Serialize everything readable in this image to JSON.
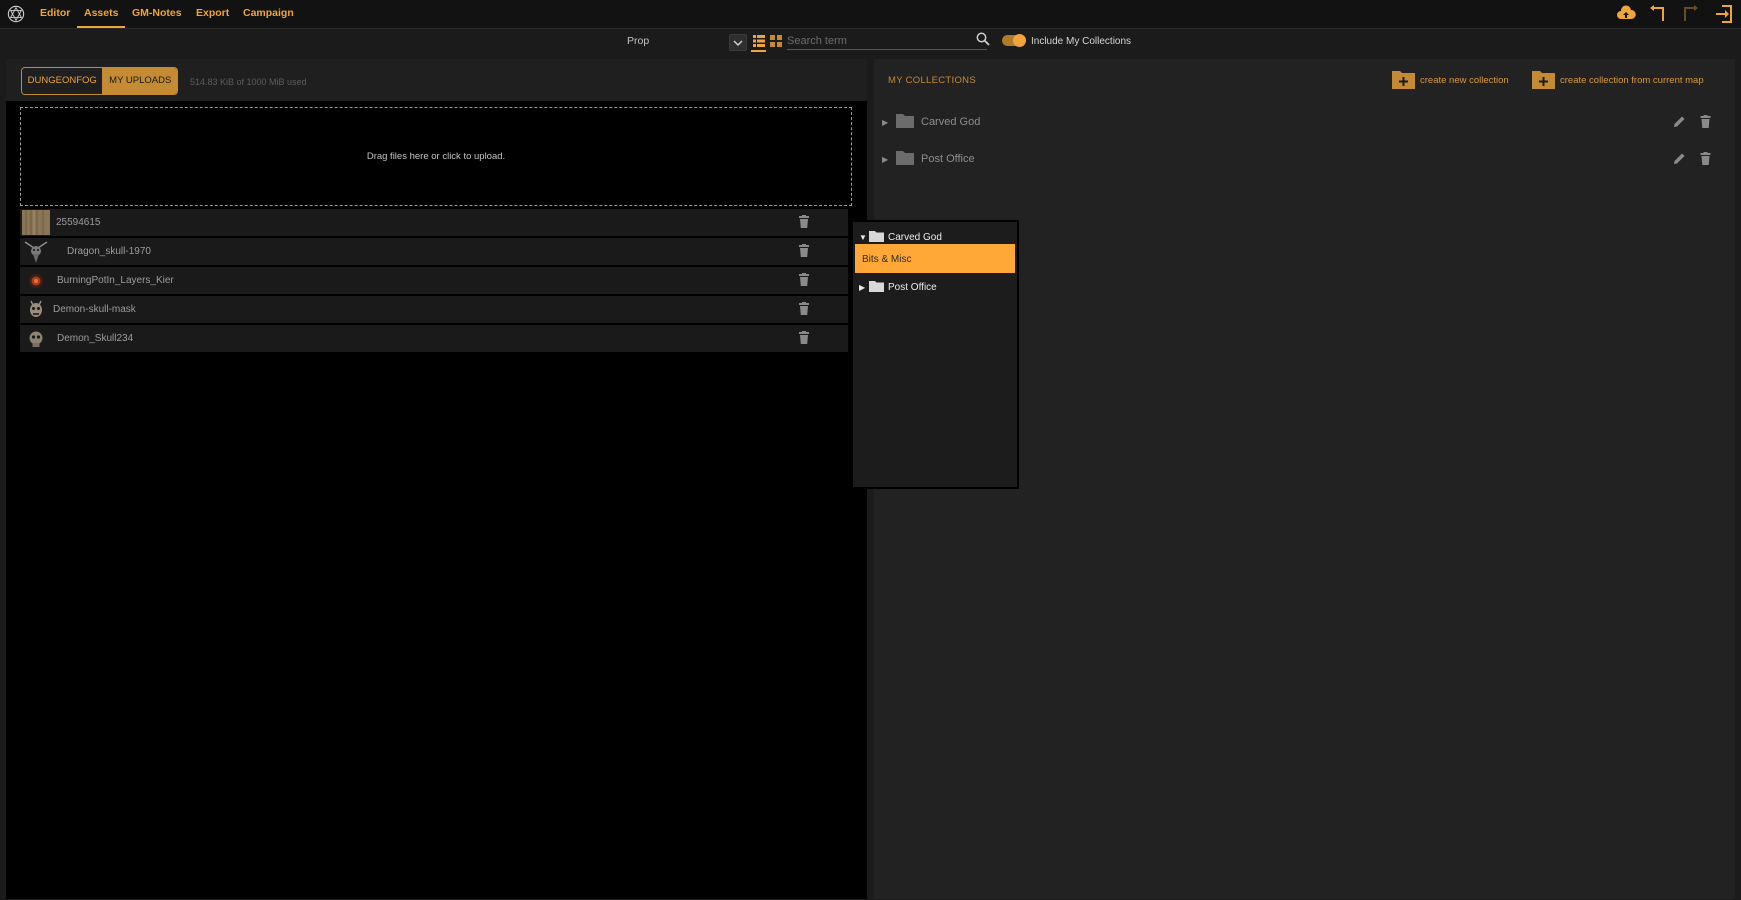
{
  "nav": {
    "items": [
      {
        "label": "Editor"
      },
      {
        "label": "Assets",
        "active": true
      },
      {
        "label": "GM-Notes"
      },
      {
        "label": "Export"
      },
      {
        "label": "Campaign"
      }
    ],
    "icons": [
      "logo-icon",
      "cloud-upload-icon",
      "undo-icon",
      "redo-icon",
      "exit-icon"
    ],
    "accent": "#f0a53c"
  },
  "filter": {
    "type_value": "Prop",
    "search_placeholder": "Search term",
    "include_collections_label": "Include My Collections",
    "include_collections_on": true,
    "view": "list"
  },
  "left": {
    "tabs": {
      "dungeonfog": "DUNGEONFOG",
      "uploads": "MY UPLOADS",
      "active": "uploads"
    },
    "storage": "514.83 KiB of 1000 MiB used",
    "upload_prompt": "Drag files here or click to upload.",
    "files": [
      {
        "name": "25594615"
      },
      {
        "name": "Dragon_skull-1970"
      },
      {
        "name": "BurningPotIn_Layers_Kier"
      },
      {
        "name": "Demon-skull-mask"
      },
      {
        "name": "Demon_Skull234"
      }
    ]
  },
  "right": {
    "title": "MY COLLECTIONS",
    "create_new": "create new collection",
    "create_from_map": "create collection from current map",
    "collections": [
      {
        "name": "Carved God"
      },
      {
        "name": "Post Office"
      }
    ]
  },
  "popup": {
    "root": "Carved God",
    "selected": "Bits & Misc",
    "other": "Post Office"
  }
}
